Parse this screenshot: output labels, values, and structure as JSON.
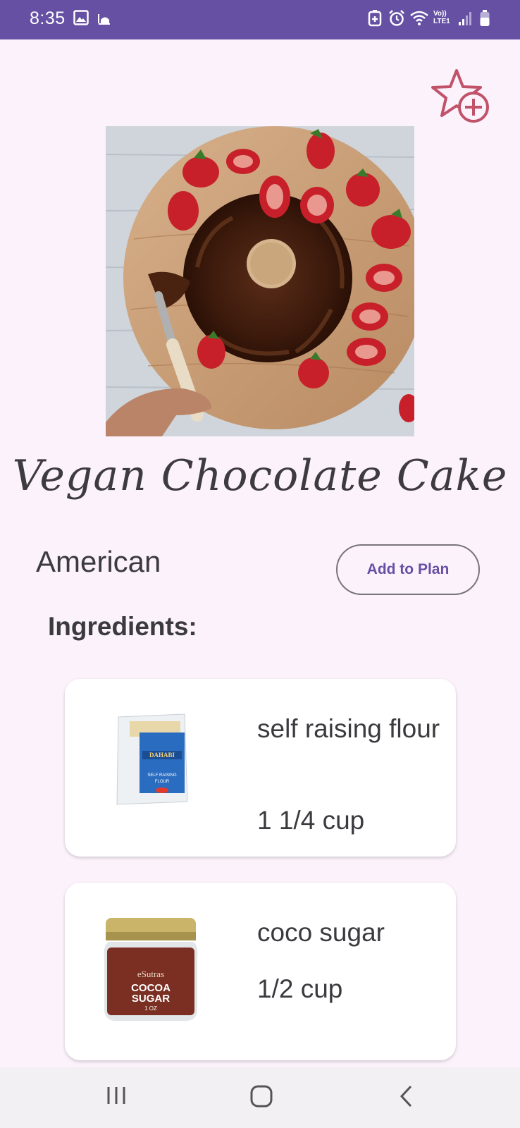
{
  "status_bar": {
    "time": "8:35",
    "network_label_top": "Vo))",
    "network_label_bottom": "LTE1",
    "icons": [
      "image-icon",
      "mosque-icon",
      "battery-saver-icon",
      "alarm-icon",
      "wifi-icon",
      "signal-icon",
      "battery-icon"
    ]
  },
  "recipe": {
    "title": "Vegan Chocolate Cake",
    "cuisine": "American",
    "add_to_plan_label": "Add to Plan",
    "favorite_icon": "star-plus-icon"
  },
  "ingredients": {
    "heading": "Ingredients:",
    "items": [
      {
        "name": "self raising flour",
        "quantity": "1 1/4 cup",
        "image_icon": "flour-bag-icon",
        "brand_text": "DAHABI",
        "product_text": "SELF RAISING FLOUR"
      },
      {
        "name": "coco sugar",
        "quantity": "1/2 cup",
        "image_icon": "sugar-jar-icon",
        "brand_text": "eSutras",
        "product_text": "COCOA SUGAR",
        "size_text": "1 OZ"
      }
    ]
  },
  "nav_bar": {
    "icons": [
      "recent-apps-icon",
      "home-icon",
      "back-icon"
    ]
  },
  "colors": {
    "status_bar": "#6650a4",
    "background": "#fcf2fb",
    "accent": "#6650a4",
    "favorite_icon": "#c0526a"
  }
}
